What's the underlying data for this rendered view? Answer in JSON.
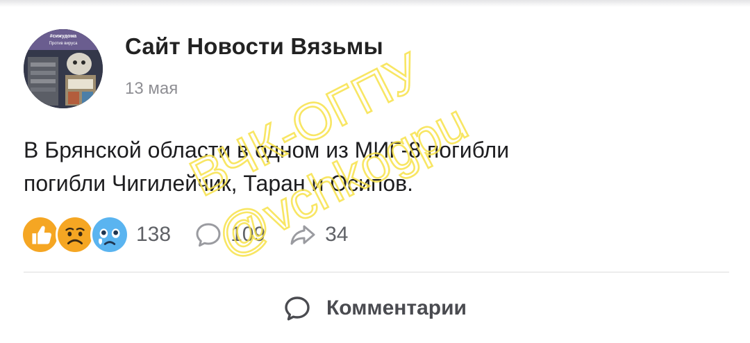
{
  "post": {
    "author": "Сайт Новости Вязьмы",
    "date": "13 мая",
    "text_line1": "В Брянской области в одном из МИГ-8 погибли",
    "text_line2": "погибли Чигилейчик, Таран и Осипов.",
    "reactions": {
      "emojis": [
        "thumbs-up",
        "sad",
        "crying"
      ],
      "count": "138"
    },
    "comments_count": "109",
    "shares_count": "34",
    "comments_button_label": "Комментарии",
    "avatar_caption_top": "#сижудома",
    "avatar_caption_bottom": "Против вируса"
  },
  "watermark": {
    "line1": "ВЧК-ОГПУ",
    "line2": "@vchkogpu",
    "color": "#f7e24a"
  },
  "colors": {
    "text": "#1d1d1f",
    "secondary": "#8e8e93",
    "icon_gray": "#9a9ba0",
    "emoji_orange": "#f5a623",
    "emoji_blue": "#5ab4f0"
  }
}
